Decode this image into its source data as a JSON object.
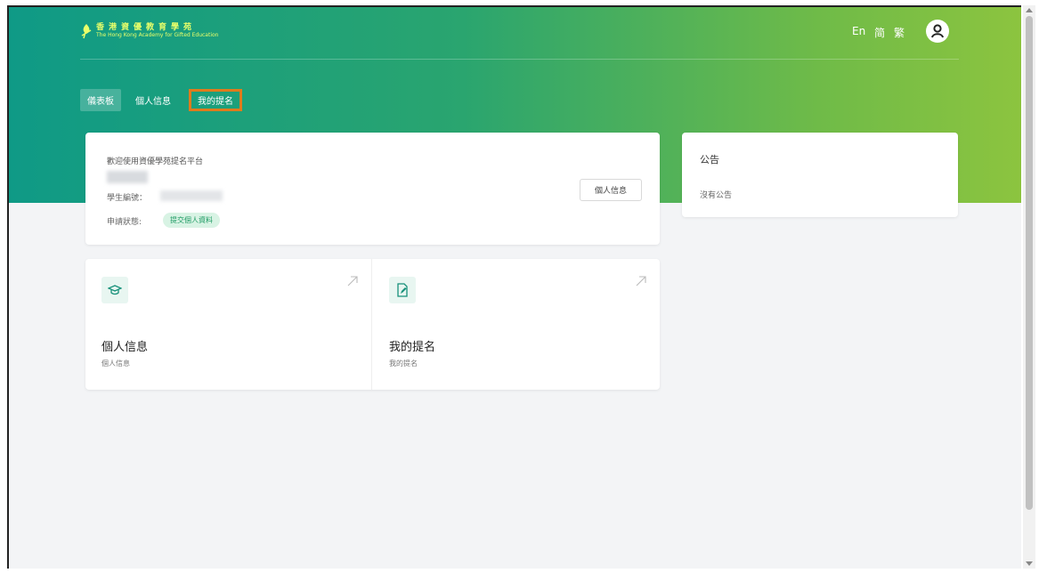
{
  "header": {
    "logo_cn": "香港資優教育學苑",
    "logo_en": "The Hong Kong Academy for Gifted Education",
    "lang_en": "En",
    "lang_sc": "简",
    "lang_tc": "繁",
    "accent_color": "#0f9a86",
    "accent_color_2": "#8cc43f"
  },
  "nav": {
    "items": [
      {
        "label": "儀表板",
        "state": "active"
      },
      {
        "label": "個人信息"
      },
      {
        "label": "我的提名",
        "state": "highlighted"
      }
    ]
  },
  "welcome": {
    "title": "歡迎使用資優學苑提名平台",
    "student_id_label": "學生編號：",
    "status_label": "申請狀態:",
    "status_value": "提交個人資料",
    "profile_button": "個人信息"
  },
  "notice": {
    "title": "公告",
    "empty_text": "沒有公告"
  },
  "tiles": [
    {
      "title": "個人信息",
      "subtitle": "個人信息",
      "icon": "graduation-cap-icon"
    },
    {
      "title": "我的提名",
      "subtitle": "我的提名",
      "icon": "document-edit-icon"
    }
  ]
}
